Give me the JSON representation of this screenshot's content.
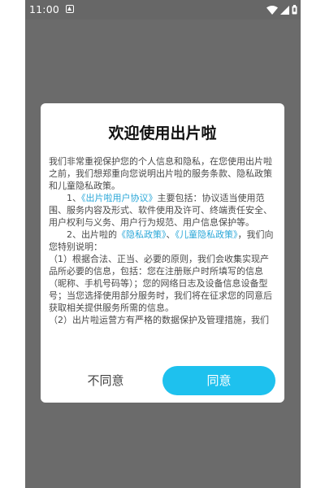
{
  "status_bar": {
    "time": "11:00",
    "notification_icon": "notification-icon",
    "wifi_icon": "wifi-icon",
    "signal_icon": "signal-icon",
    "battery_icon": "battery-icon"
  },
  "dialog": {
    "title": "欢迎使用出片啦",
    "intro": "我们非常重视保护您的个人信息和隐私，在您使用出片啦之前，我们想郑重向您说明出片啦的服务条款、隐私政策和儿童隐私政策。",
    "item1_prefix": "1、",
    "item1_link": "《出片啦用户协议》",
    "item1_text": "主要包括：协议适当使用范围、服务内容及形式、软件使用及许可、终端责任安全、用户权利与义务、用户行为规范、用户信息保护等。",
    "item2_prefix": "2、出片啦的",
    "item2_link_privacy": "《隐私政策》",
    "item2_sep": "、",
    "item2_link_child": "《儿童隐私政策》",
    "item2_text": "，我们向您特别说明：",
    "sub1": "（1）根据合法、正当、必要的原则，我们会收集实现产品所必要的信息，包括：您在注册账户时所填写的信息（昵称、手机号码等）；您的网络日志及设备信息设备型号；当您选择使用部分服务时，我们将在征求您的同意后获取相关提供服务所需的信息。",
    "sub2": "（2）出片啦运营方有严格的数据保护及管理措施，我们",
    "disagree_label": "不同意",
    "agree_label": "同意"
  },
  "colors": {
    "link": "#2aa7d8",
    "accent": "#1ec1ee",
    "overlay": "#6b6b6b"
  }
}
